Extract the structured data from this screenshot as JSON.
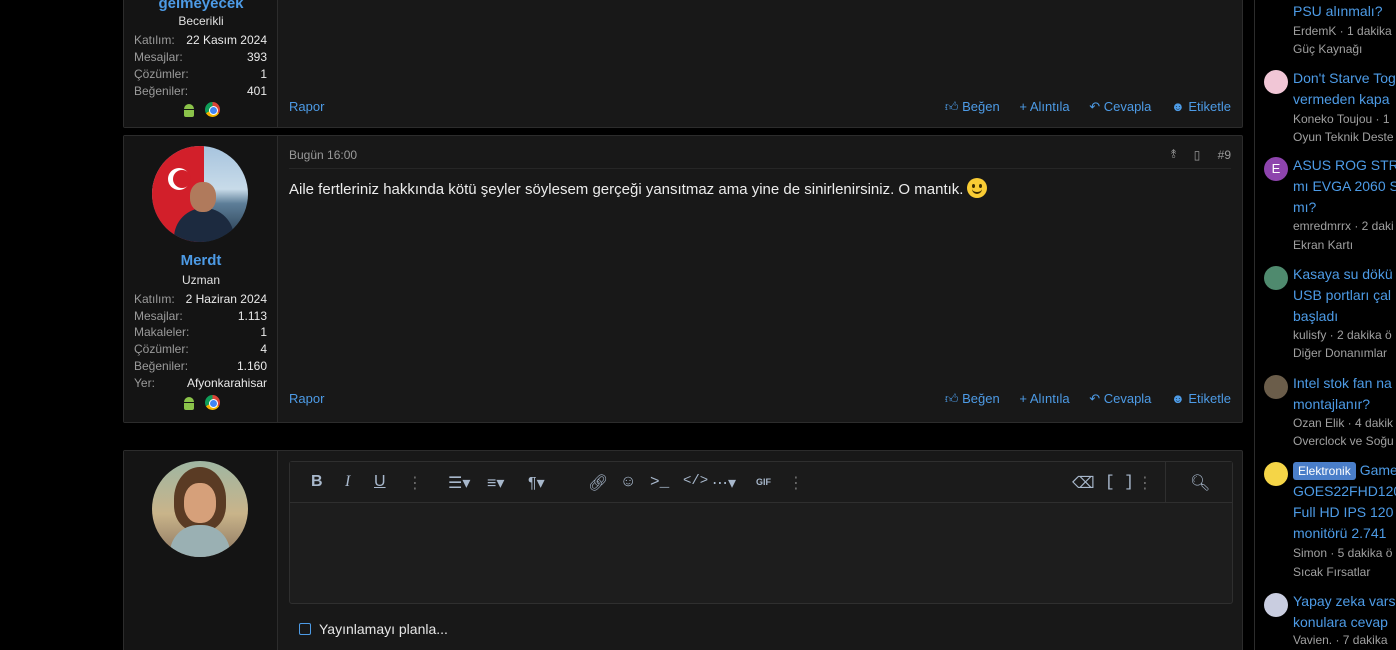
{
  "post1": {
    "username": "gelmeyecek",
    "user_title": "Becerikli",
    "stats": [
      {
        "label": "Katılım:",
        "value": "22 Kasım 2024"
      },
      {
        "label": "Mesajlar:",
        "value": "393"
      },
      {
        "label": "Çözümler:",
        "value": "1"
      },
      {
        "label": "Beğeniler:",
        "value": "401"
      }
    ],
    "report": "Rapor",
    "actions": {
      "like": "Beğen",
      "quote": "+ Alıntıla",
      "reply": "Cevapla",
      "tag": "Etiketle"
    }
  },
  "post2": {
    "username": "Merdt",
    "user_title": "Uzman",
    "stats": [
      {
        "label": "Katılım:",
        "value": "2 Haziran 2024"
      },
      {
        "label": "Mesajlar:",
        "value": "1.113"
      },
      {
        "label": "Makaleler:",
        "value": "1"
      },
      {
        "label": "Çözümler:",
        "value": "4"
      },
      {
        "label": "Beğeniler:",
        "value": "1.160"
      },
      {
        "label": "Yer:",
        "value": "Afyonkarahisar"
      }
    ],
    "date": "Bugün 16:00",
    "post_number": "#9",
    "body": "Aile fertleriniz hakkında kötü şeyler söylesem gerçeği yansıtmaz ama yine de sinirlenirsiniz. O mantık.",
    "report": "Rapor",
    "actions": {
      "like": "Beğen",
      "quote": "+ Alıntıla",
      "reply": "Cevapla",
      "tag": "Etiketle"
    }
  },
  "editor": {
    "schedule_label": "Yayınlamayı planla...",
    "toolbar_icons": [
      "bold-icon",
      "italic-icon",
      "underline-icon",
      "more-icon",
      "list-icon",
      "align-icon",
      "paragraph-icon",
      "link-icon",
      "emoji-icon",
      "terminal-icon",
      "code-icon",
      "insert-more-icon",
      "gif-icon",
      "more-icon",
      "eraser-icon",
      "brackets-icon",
      "more-icon",
      "preview-icon"
    ],
    "gif_label": "GIF"
  },
  "sidebar_threads": [
    {
      "title_lines": [
        "PSU alınmalı?"
      ],
      "meta": "ErdemK · 1 dakika",
      "forum": "Güç Kaynağı"
    },
    {
      "title_lines": [
        "Don't Starve Tog",
        "vermeden kapa"
      ],
      "meta": "Koneko Toujou · 1",
      "forum": "Oyun Teknik Deste"
    },
    {
      "title_lines": [
        "ASUS ROG STRI",
        "mı EVGA 2060 S",
        "mı?"
      ],
      "meta": "emredmrrx · 2 daki",
      "forum": "Ekran Kartı",
      "avatar_letter": "E"
    },
    {
      "title_lines": [
        "Kasaya su dökü",
        "USB portları çal",
        "başladı"
      ],
      "meta": "kulisfy · 2 dakika ö",
      "forum": "Diğer Donanımlar"
    },
    {
      "title_lines": [
        "Intel stok fan na",
        "montajlanır?"
      ],
      "meta": "Ozan Elik · 4 dakik",
      "forum": "Overclock ve Soğu"
    },
    {
      "badge": "Elektronik",
      "title_lines": [
        "Game",
        "GOES22FHD120",
        "Full HD IPS 120",
        "monitörü 2.741"
      ],
      "meta": "Simon · 5 dakika ö",
      "forum": "Sıcak Fırsatlar"
    },
    {
      "title_lines": [
        "Yapay zeka vars",
        "konulara cevap"
      ],
      "meta": "Vavien. · 7 dakika",
      "forum": ""
    }
  ],
  "colors": {
    "accent": "#4d9be6",
    "background": "#000000",
    "panel": "#181818"
  }
}
